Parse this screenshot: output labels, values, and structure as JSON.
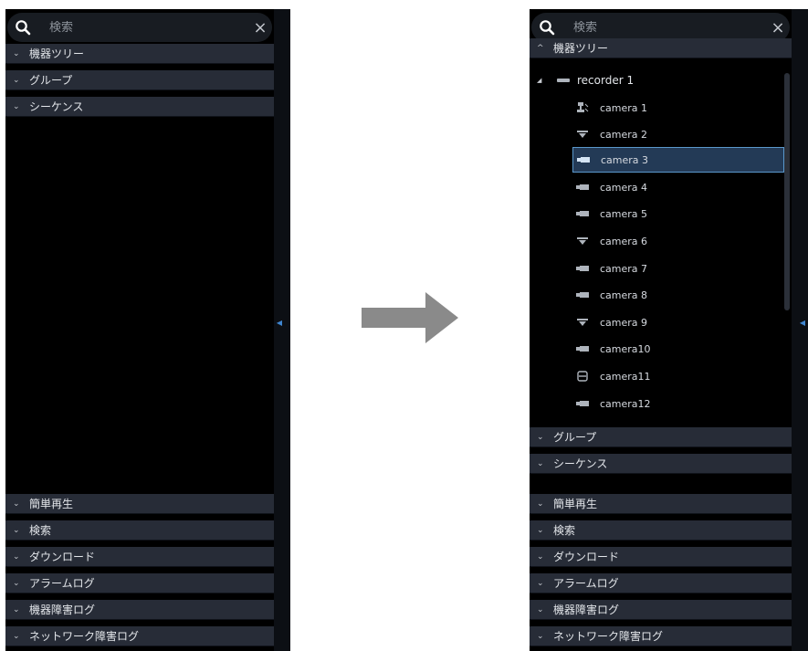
{
  "arrow_color": "#8a8a8a",
  "left_panel": {
    "search": {
      "placeholder": "検索",
      "clear": "×"
    },
    "top_sections": [
      {
        "label": "機器ツリー",
        "chevron": "⌄"
      },
      {
        "label": "グループ",
        "chevron": "⌄"
      },
      {
        "label": "シーケンス",
        "chevron": "⌄"
      }
    ],
    "bottom_sections": [
      {
        "label": "簡単再生",
        "chevron": "⌄"
      },
      {
        "label": "検索",
        "chevron": "⌄"
      },
      {
        "label": "ダウンロード",
        "chevron": "⌄"
      },
      {
        "label": "アラームログ",
        "chevron": "⌄"
      },
      {
        "label": "機器障害ログ",
        "chevron": "⌄"
      },
      {
        "label": "ネットワーク障害ログ",
        "chevron": "⌄"
      }
    ]
  },
  "right_panel": {
    "search": {
      "placeholder": "検索",
      "clear": "×"
    },
    "device_tree": {
      "label": "機器ツリー",
      "chevron": "^",
      "recorder": {
        "label": "recorder 1",
        "expand": "◢"
      },
      "cameras": [
        {
          "label": "camera 1",
          "icon": "ptz-camera-icon"
        },
        {
          "label": "camera 2",
          "icon": "dome-camera-icon"
        },
        {
          "label": "camera 3",
          "icon": "box-camera-icon",
          "selected": true
        },
        {
          "label": "camera 4",
          "icon": "box-camera-icon"
        },
        {
          "label": "camera 5",
          "icon": "box-camera-icon"
        },
        {
          "label": "camera 6",
          "icon": "dome-camera-icon"
        },
        {
          "label": "camera 7",
          "icon": "box-camera-icon"
        },
        {
          "label": "camera 8",
          "icon": "box-camera-icon"
        },
        {
          "label": "camera 9",
          "icon": "dome-camera-icon"
        },
        {
          "label": "camera10",
          "icon": "box-camera-icon"
        },
        {
          "label": "camera11",
          "icon": "fisheye-camera-icon"
        },
        {
          "label": "camera12",
          "icon": "box-camera-icon"
        }
      ]
    },
    "sections_after_tree": [
      {
        "label": "グループ",
        "chevron": "⌄"
      },
      {
        "label": "シーケンス",
        "chevron": "⌄"
      }
    ],
    "bottom_sections": [
      {
        "label": "簡単再生",
        "chevron": "⌄"
      },
      {
        "label": "検索",
        "chevron": "⌄"
      },
      {
        "label": "ダウンロード",
        "chevron": "⌄"
      },
      {
        "label": "アラームログ",
        "chevron": "⌄"
      },
      {
        "label": "機器障害ログ",
        "chevron": "⌄"
      },
      {
        "label": "ネットワーク障害ログ",
        "chevron": "⌄"
      }
    ]
  }
}
